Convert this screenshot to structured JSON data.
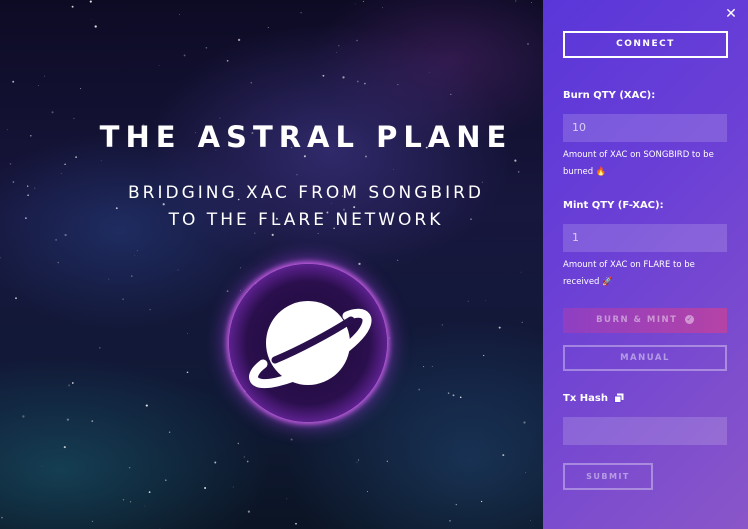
{
  "hero": {
    "title": "THE ASTRAL PLANE",
    "subtitle_line1": "BRIDGING XAC FROM SONGBIRD",
    "subtitle_line2": "TO THE FLARE NETWORK",
    "logo_icon": "planet-icon"
  },
  "panel": {
    "close_label": "✕",
    "connect_label": "CONNECT",
    "burn": {
      "label": "Burn QTY (XAC):",
      "value": "10",
      "help_line1": "Amount of XAC on SONGBIRD to be",
      "help_line2": "burned",
      "help_icon": "🔥",
      "help_icon_name": "fire-icon"
    },
    "mint": {
      "label": "Mint QTY (F-XAC):",
      "value": "1",
      "help_line1": "Amount of XAC on FLARE to be",
      "help_line2": "received",
      "help_icon": "🚀",
      "help_icon_name": "rocket-icon"
    },
    "burn_mint_label": "BURN & MINT",
    "burn_mint_check": "✓",
    "manual_label": "MANUAL",
    "tx_hash_label": "Tx Hash",
    "tx_hash_value": "",
    "submit_label": "SUBMIT"
  },
  "colors": {
    "panel_gradient_start": "#5a36d9",
    "panel_gradient_end": "#8a56c8",
    "orb_glow": "#e46dff",
    "burn_mint_start": "#8e3fc3",
    "burn_mint_end": "#b543a6"
  }
}
